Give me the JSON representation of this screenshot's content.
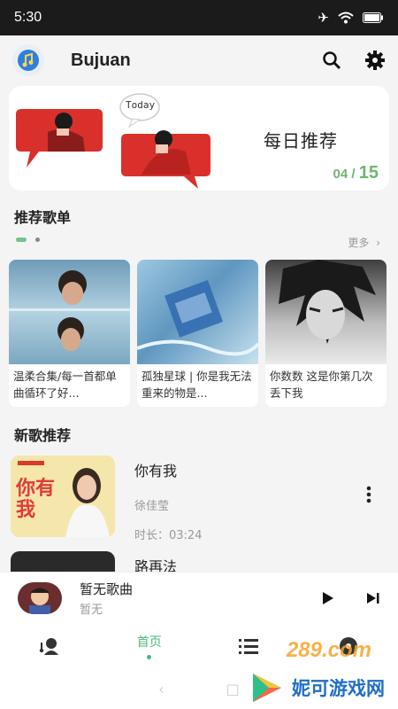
{
  "status_bar": {
    "time": "5:30"
  },
  "header": {
    "title": "Bujuan"
  },
  "banner": {
    "badge": "Today",
    "title": "每日推荐",
    "current": "04",
    "total": "15"
  },
  "playlists": {
    "title": "推荐歌单",
    "more": "更多",
    "items": [
      {
        "name": "温柔合集/每一首都单曲循环了好..."
      },
      {
        "name": "孤独星球 | 你是我无法重来的物是..."
      },
      {
        "name": "你数数 这是你第几次丢下我"
      }
    ]
  },
  "new_songs": {
    "title": "新歌推荐",
    "items": [
      {
        "title": "你有我",
        "artist": "徐佳莹",
        "duration": "时长：03:24",
        "cover_text": "你有我"
      },
      {
        "title": "路再法"
      }
    ]
  },
  "player": {
    "song": "暂无歌曲",
    "artist": "暂无"
  },
  "tabs": {
    "home": "首页"
  },
  "watermark": {
    "text": "妮可游戏网",
    "top": "289.com"
  },
  "colors": {
    "accent": "#4fb47d",
    "banner_red": "#d9302b",
    "counter": "#6fb571"
  }
}
